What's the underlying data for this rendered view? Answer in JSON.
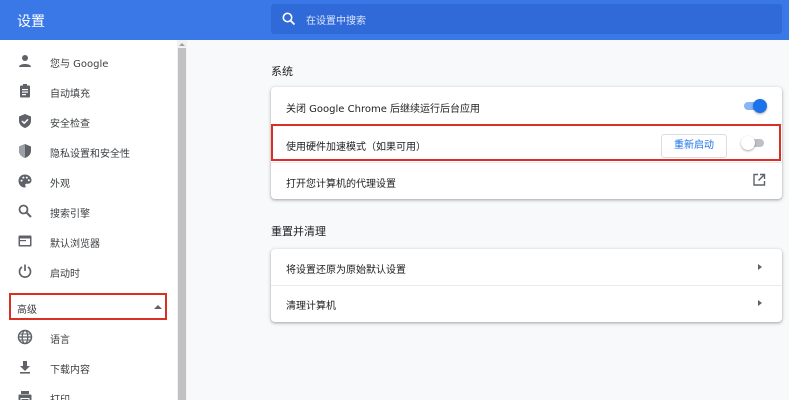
{
  "header": {
    "title": "设置",
    "search_placeholder": "在设置中搜索",
    "search_icon": "search-icon"
  },
  "sidebar": {
    "items": [
      {
        "label": "您与 Google",
        "icon": "person-icon"
      },
      {
        "label": "自动填充",
        "icon": "clipboard-icon"
      },
      {
        "label": "安全检查",
        "icon": "shield-check-icon"
      },
      {
        "label": "隐私设置和安全性",
        "icon": "shield-privacy-icon"
      },
      {
        "label": "外观",
        "icon": "palette-icon"
      },
      {
        "label": "搜索引擎",
        "icon": "search-icon"
      },
      {
        "label": "默认浏览器",
        "icon": "browser-icon"
      },
      {
        "label": "启动时",
        "icon": "power-icon"
      }
    ],
    "advanced": {
      "label": "高级",
      "expanded": true
    },
    "advanced_items": [
      {
        "label": "语言",
        "icon": "globe-icon"
      },
      {
        "label": "下载内容",
        "icon": "download-icon"
      },
      {
        "label": "打印",
        "icon": "printer-icon"
      }
    ]
  },
  "system": {
    "title": "系统",
    "rows": [
      {
        "label": "关闭 Google Chrome 后继续运行后台应用",
        "toggle": true
      },
      {
        "label": "使用硬件加速模式（如果可用）",
        "toggle": false,
        "button": "重新启动"
      },
      {
        "label": "打开您计算机的代理设置",
        "icon": "open-in-new-icon"
      }
    ]
  },
  "reset": {
    "title": "重置并清理",
    "rows": [
      {
        "label": "将设置还原为原始默认设置"
      },
      {
        "label": "清理计算机"
      }
    ]
  },
  "colors": {
    "header": "#3b78e7",
    "toggle_on": "#1a73e8",
    "highlight": "#d93025"
  }
}
